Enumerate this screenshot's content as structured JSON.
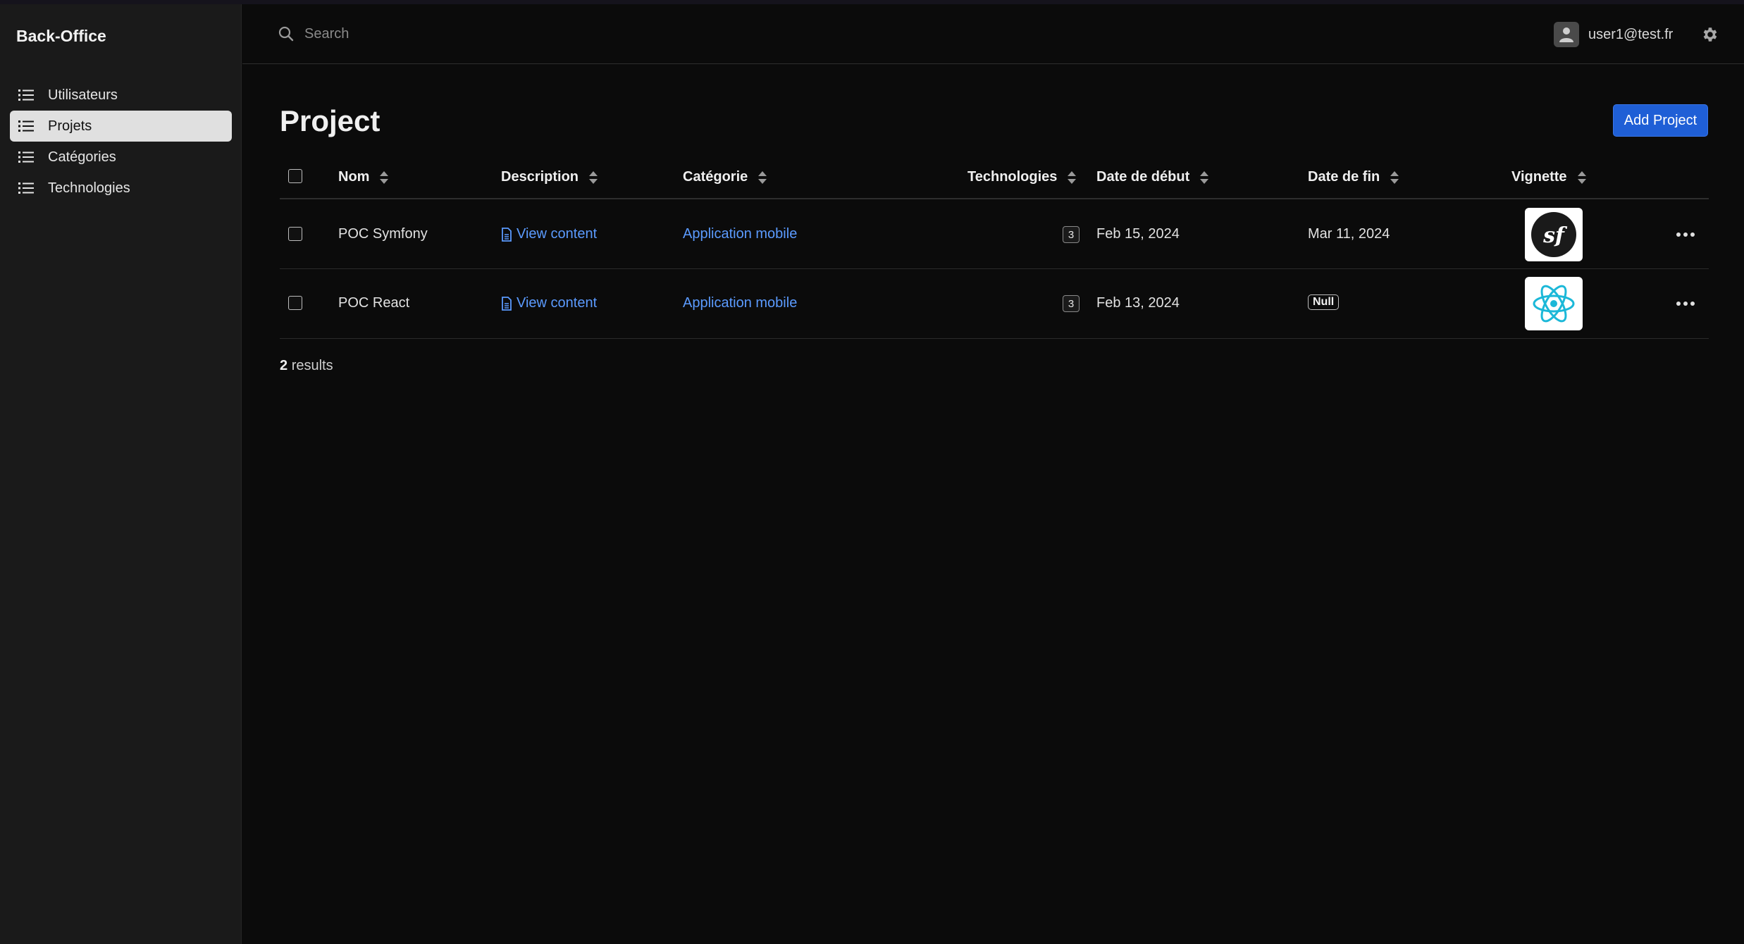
{
  "app": {
    "brand": "Back-Office"
  },
  "sidebar": {
    "items": [
      {
        "label": "Utilisateurs",
        "active": false
      },
      {
        "label": "Projets",
        "active": true
      },
      {
        "label": "Catégories",
        "active": false
      },
      {
        "label": "Technologies",
        "active": false
      }
    ]
  },
  "header": {
    "search_placeholder": "Search",
    "user_email": "user1@test.fr",
    "icons": [
      "search-icon",
      "user-avatar-icon",
      "gear-icon"
    ]
  },
  "page": {
    "title": "Project",
    "add_button_label": "Add Project"
  },
  "table": {
    "columns": [
      "Nom",
      "Description",
      "Catégorie",
      "Technologies",
      "Date de début",
      "Date de fin",
      "Vignette"
    ],
    "rows": [
      {
        "nom": "POC Symfony",
        "description": "View content",
        "categorie": "Application mobile",
        "technologies": "3",
        "date_debut": "Feb 15, 2024",
        "date_fin": "Mar 11, 2024",
        "vignette": "symfony-logo"
      },
      {
        "nom": "POC React",
        "description": "View content",
        "categorie": "Application mobile",
        "technologies": "3",
        "date_debut": "Feb 13, 2024",
        "date_fin": "Null",
        "vignette": "react-logo"
      }
    ]
  },
  "results": {
    "count": "2",
    "label": "results"
  },
  "colors": {
    "accent": "#1f5fd6",
    "link": "#5b9bff",
    "background": "#0b0b0b",
    "sidebar": "#1a1a1a"
  }
}
